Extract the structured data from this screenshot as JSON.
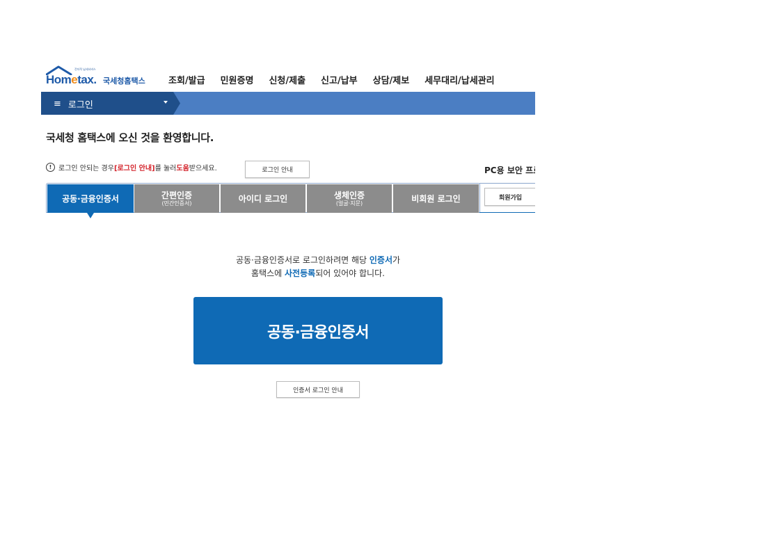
{
  "header": {
    "logo_tagline": "전자적 납세서비스",
    "logo_brand_pre": "Hom",
    "logo_brand_e": "e",
    "logo_brand_post": "tax.",
    "logo_korean": "국세청홈택스"
  },
  "top_nav": {
    "items": [
      {
        "label": "조회/발급"
      },
      {
        "label": "민원증명"
      },
      {
        "label": "신청/제출"
      },
      {
        "label": "신고/납부"
      },
      {
        "label": "상담/제보"
      },
      {
        "label": "세무대리/납세관리"
      }
    ]
  },
  "menu_bar": {
    "hamburger": "≡",
    "label": "로그인"
  },
  "welcome": "국세청 홈택스에 오신 것을 환영합니다.",
  "help": {
    "icon": "!",
    "text_1": "로그인 안되는 경우 ",
    "red_1": "[로그인 안내]",
    "text_2": "를 눌러 ",
    "red_2": "도움",
    "text_3": "받으세요.",
    "button": "로그인 안내"
  },
  "pc_security": "PC용 보안 프로그램",
  "tabs": [
    {
      "main": "공동·금융인증서",
      "sub": ""
    },
    {
      "main": "간편인증",
      "sub": "(민간인증서)"
    },
    {
      "main": "아이디 로그인",
      "sub": ""
    },
    {
      "main": "생체인증",
      "sub": "(얼굴·지문)"
    },
    {
      "main": "비회원 로그인",
      "sub": ""
    }
  ],
  "signup_button": "회원가입",
  "description": {
    "line1_pre": "공동·금융인증서로 로그인하려면 해당 ",
    "line1_blue": "인증서",
    "line1_post": "가",
    "line2_pre": "홈택스에 ",
    "line2_blue": "사전등록",
    "line2_post": "되어 있어야 합니다."
  },
  "cert_button": "공동·금융인증서",
  "cert_guide_button": "인증서 로그인 안내",
  "colors": {
    "primary_blue": "#0f6ab5",
    "menu_bar_blue": "#4b7ec3",
    "menu_bar_dark": "#1f4f8a",
    "tab_gray": "#8c8c8c",
    "help_red": "#d3222a",
    "logo_orange": "#f08c1a"
  }
}
